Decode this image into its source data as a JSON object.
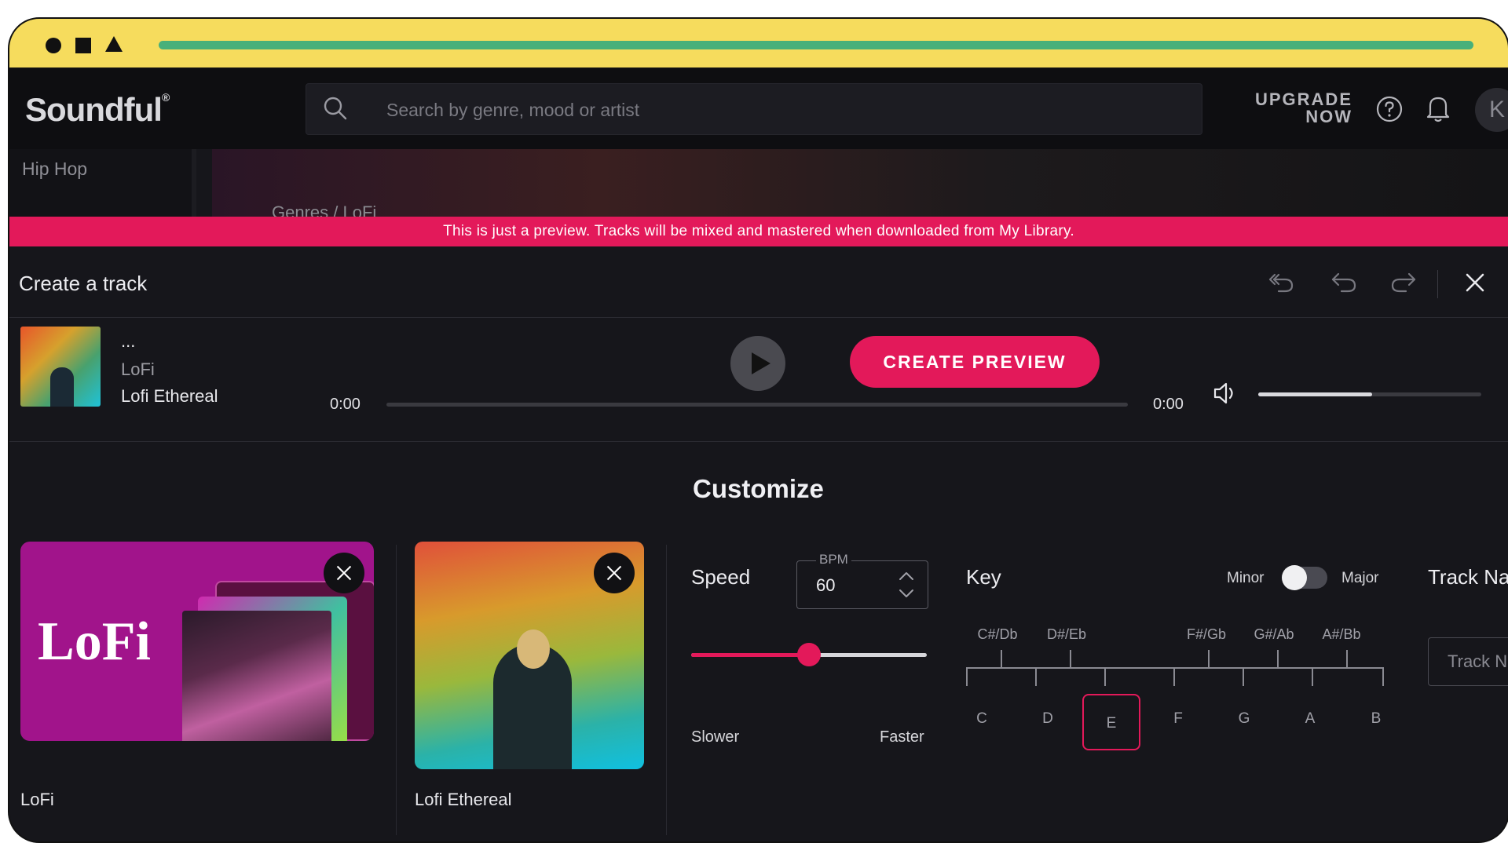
{
  "window": {
    "accent_bar_color": "#48b07a",
    "titlebar_color": "#f6dc5d"
  },
  "topbar": {
    "logo": "Soundful",
    "logo_mark": "®",
    "search_placeholder": "Search by genre, mood or artist",
    "upgrade_line1": "UPGRADE",
    "upgrade_line2": "NOW",
    "avatar_initial": "K"
  },
  "sidebar": {
    "items": [
      {
        "label": "Hip Hop"
      }
    ]
  },
  "breadcrumb": {
    "text": "Genres / LoFi"
  },
  "banner": {
    "text": "This is just a preview. Tracks will be mixed and mastered when downloaded from My Library.",
    "color": "#e3195a"
  },
  "panel": {
    "title": "Create a track",
    "header_icons": [
      "restart-icon",
      "undo-icon",
      "redo-icon",
      "close-icon"
    ]
  },
  "player": {
    "track_title": "...",
    "genre": "LoFi",
    "template_name": "Lofi Ethereal",
    "time_elapsed": "0:00",
    "time_total": "0:00",
    "progress_fraction": 0,
    "create_button": "CREATE PREVIEW",
    "volume_fraction": 0.51
  },
  "customize": {
    "title": "Customize",
    "genre_card": {
      "art_text": "LoFi",
      "label": "LoFi"
    },
    "template_card": {
      "label": "Lofi Ethereal"
    },
    "speed": {
      "label": "Speed",
      "bpm_legend": "BPM",
      "bpm_value": "60",
      "slider_fraction": 0.5,
      "slower_label": "Slower",
      "faster_label": "Faster"
    },
    "key": {
      "label": "Key",
      "minor_label": "Minor",
      "major_label": "Major",
      "mode_selected": "Minor",
      "sharps": [
        "C#/Db",
        "D#/Eb",
        "F#/Gb",
        "G#/Ab",
        "A#/Bb"
      ],
      "naturals": [
        "C",
        "D",
        "E",
        "F",
        "G",
        "A",
        "B"
      ],
      "selected_note": "E"
    },
    "track_name": {
      "label": "Track Name",
      "placeholder": "Track Name"
    }
  }
}
